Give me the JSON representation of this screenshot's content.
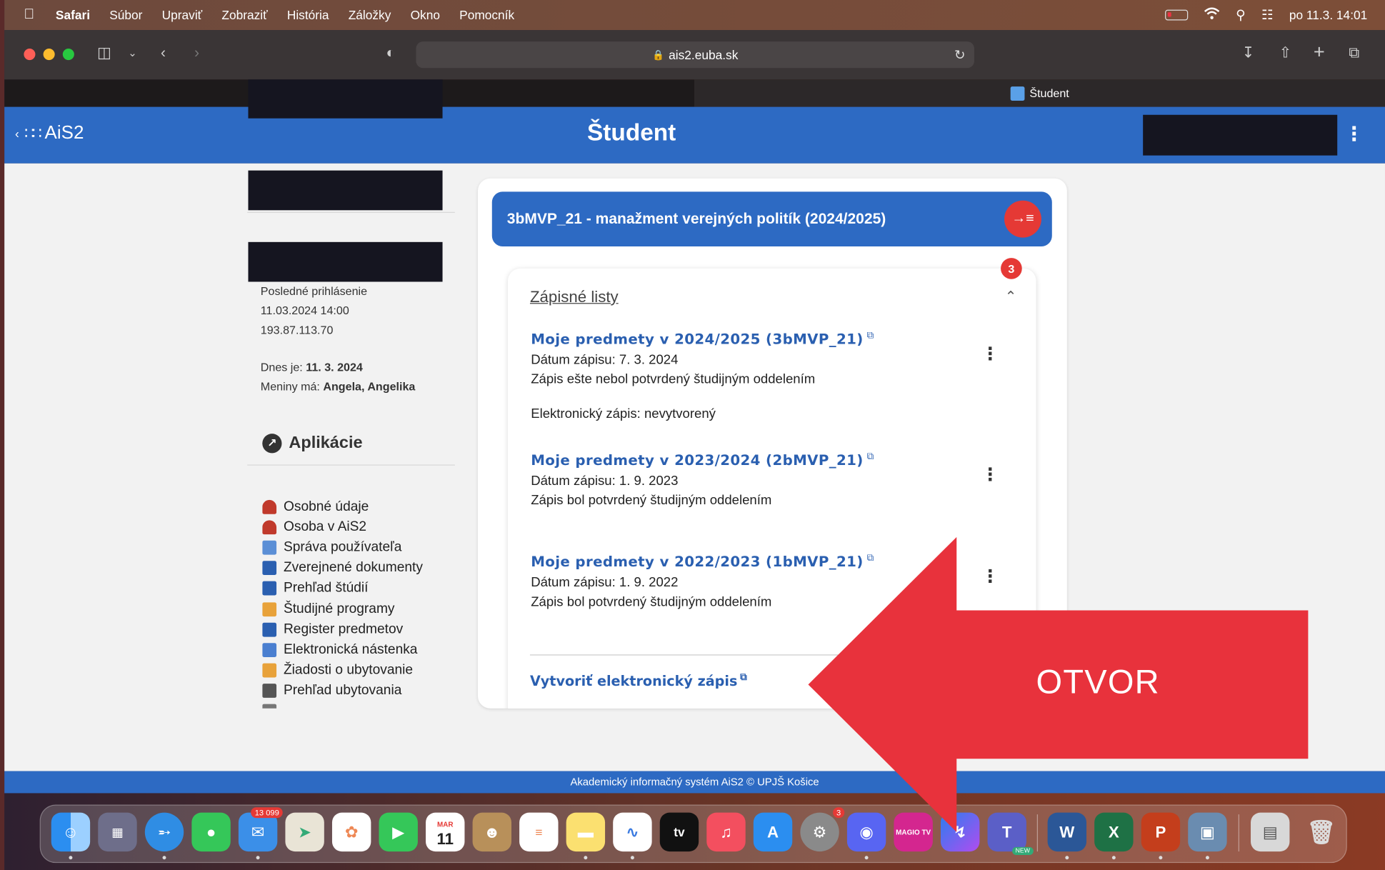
{
  "menubar": {
    "app": "Safari",
    "items": [
      "Súbor",
      "Upraviť",
      "Zobraziť",
      "História",
      "Záložky",
      "Okno",
      "Pomocník"
    ],
    "datetime": "po 11.3.  14:01"
  },
  "browser": {
    "url": "ais2.euba.sk",
    "active_tab": "Študent"
  },
  "app": {
    "logo": "AiS2",
    "title": "Študent"
  },
  "sidebar": {
    "last_login_label": "Posledné prihlásenie",
    "last_login_time": "11.03.2024 14:00",
    "last_login_ip": "193.87.113.70",
    "today_label": "Dnes je:",
    "today_value": "11. 3. 2024",
    "nameday_label": "Meniny má:",
    "nameday_value": "Angela, Angelika",
    "apps_heading": "Aplikácie",
    "apps": [
      {
        "label": "Osobné údaje",
        "color": "#c0392b"
      },
      {
        "label": "Osoba v AiS2",
        "color": "#c0392b"
      },
      {
        "label": "Správa používateľa",
        "color": "#5b8fd6"
      },
      {
        "label": "Zverejnené dokumenty",
        "color": "#2a5fb0"
      },
      {
        "label": "Prehľad štúdií",
        "color": "#2a5fb0"
      },
      {
        "label": "Študijné programy",
        "color": "#e8a23a"
      },
      {
        "label": "Register predmetov",
        "color": "#2a5fb0"
      },
      {
        "label": "Elektronická nástenka",
        "color": "#4a7fd0"
      },
      {
        "label": "Žiadosti o ubytovanie",
        "color": "#e8a23a"
      },
      {
        "label": "Prehľad ubytovania",
        "color": "#555555"
      },
      {
        "label": "",
        "color": "#777777"
      }
    ]
  },
  "main": {
    "study_program": "3bMVP_21 - manažment verejných politík (2024/2025)",
    "study_btn": "→≡",
    "badge": "3",
    "section_title": "Zápisné listy",
    "entries": [
      {
        "title": "Moje predmety v 2024/2025 (3bMVP_21)",
        "date": "Dátum zápisu: 7. 3. 2024",
        "status": "Zápis ešte nebol potvrdený študijným oddelením",
        "extra": "Elektronický zápis: nevytvorený"
      },
      {
        "title": "Moje predmety v 2023/2024 (2bMVP_21)",
        "date": "Dátum zápisu: 1. 9. 2023",
        "status": "Zápis bol potvrdený študijným oddelením",
        "extra": ""
      },
      {
        "title": "Moje predmety v 2022/2023 (1bMVP_21)",
        "date": "Dátum zápisu: 1. 9. 2022",
        "status": "Zápis bol potvrdený študijným oddelením",
        "extra": ""
      }
    ],
    "create_link": "Vytvoriť elektronický zápis"
  },
  "footer": "Akademický informačný systém AiS2 © UPJŠ Košice",
  "annotation": {
    "text": "OTVOR",
    "color": "#e8323c"
  },
  "dock": {
    "mail_badge": "13 099",
    "calendar_month": "MAR",
    "calendar_day": "11",
    "settings_badge": "3",
    "tv_label": "tv",
    "magio_label": "MAGIO TV",
    "teams_label": "NEW"
  }
}
